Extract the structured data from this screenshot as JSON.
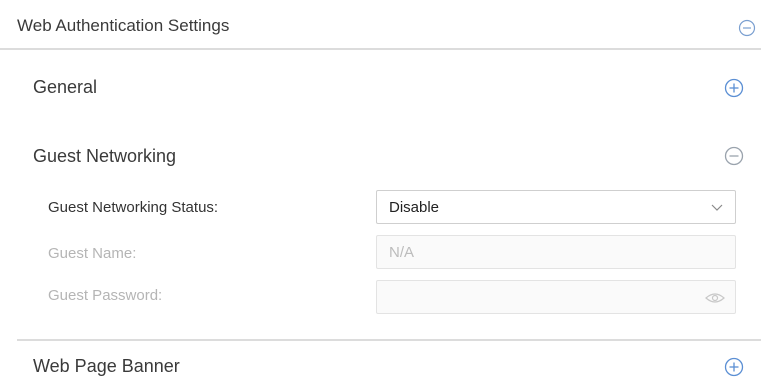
{
  "header": {
    "title": "Web Authentication Settings",
    "collapse_icon": "minus-circle-icon"
  },
  "sections": {
    "general": {
      "title": "General",
      "icon": "plus-circle-icon"
    },
    "guest_networking": {
      "title": "Guest Networking",
      "icon": "minus-circle-icon",
      "fields": {
        "status_label": "Guest Networking Status:",
        "status_value": "Disable",
        "name_label": "Guest Name:",
        "name_value": "N/A",
        "password_label": "Guest Password:",
        "password_value": ""
      }
    },
    "web_page_banner": {
      "title": "Web Page Banner",
      "icon": "plus-circle-icon"
    }
  },
  "colors": {
    "icon_blue": "#5b8fd4",
    "icon_gray": "#9aa3ad",
    "divider": "#dcdcdc"
  }
}
